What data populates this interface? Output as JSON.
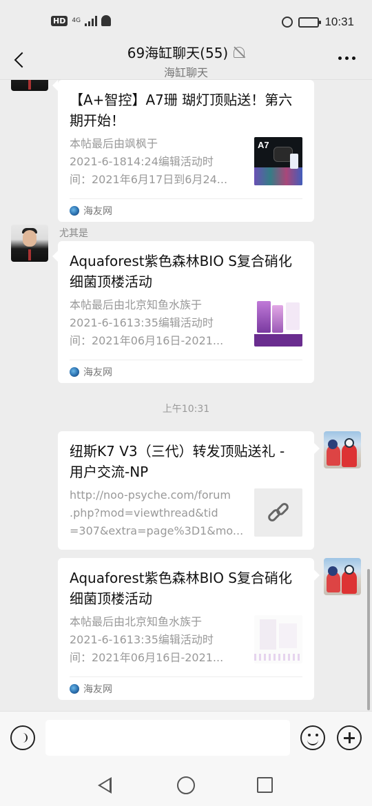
{
  "status_bar": {
    "hd": "HD",
    "network": "4G",
    "time": "10:31",
    "battery_level": 0.75,
    "icons": [
      "signal-icon",
      "notification-bell-icon",
      "alarm-icon",
      "battery-icon"
    ]
  },
  "header": {
    "title": "69海缸聊天(55)",
    "subtitle": "海缸聊天",
    "icons": [
      "back-arrow-icon",
      "mute-icon",
      "more-dots-icon"
    ]
  },
  "messages": [
    {
      "id": "m1",
      "side": "left",
      "sender": "",
      "card": {
        "title": "【A+智控】A7珊 瑚灯顶贴送！第六期开始！",
        "desc": [
          "本帖最后由飒枫于",
          "2021-6-1814:24编辑活动时",
          "间：2021年6月17日到6月24..."
        ],
        "thumb": "a7-product",
        "thumb_text": "A7",
        "source": "海友网"
      }
    },
    {
      "id": "m2",
      "side": "left",
      "sender": "尤其是",
      "card": {
        "title": "Aquaforest紫色森林BIO S复合硝化细菌顶楼活动",
        "desc": [
          "本帖最后由北京知鱼水族于",
          "2021-6-1613:35编辑活动时",
          "间：2021年06月16日-2021..."
        ],
        "thumb": "aquaforest-product",
        "source": "海友网"
      }
    },
    {
      "id": "divider",
      "time": "上午10:31"
    },
    {
      "id": "m3",
      "side": "right",
      "card": {
        "title": "纽斯K7 V3（三代）转发顶贴送礼 - 用户交流-NP",
        "desc": [
          "http://noo-psyche.com/forum",
          ".php?mod=viewthread&tid",
          "=307&extra=page%3D1&mo..."
        ],
        "thumb": "link-icon"
      }
    },
    {
      "id": "m4",
      "side": "right",
      "card": {
        "title": "Aquaforest紫色森林BIO S复合硝化细菌顶楼活动",
        "desc": [
          "本帖最后由北京知鱼水族于",
          "2021-6-1613:35编辑活动时",
          "间：2021年06月16日-2021..."
        ],
        "thumb": "aquaforest-product-faint",
        "source": "海友网"
      }
    }
  ],
  "input_bar": {
    "placeholder": "",
    "icons": [
      "voice-icon",
      "emoji-icon",
      "plus-icon"
    ]
  },
  "system_nav": {
    "icons": [
      "nav-back-icon",
      "nav-home-icon",
      "nav-recents-icon"
    ]
  }
}
